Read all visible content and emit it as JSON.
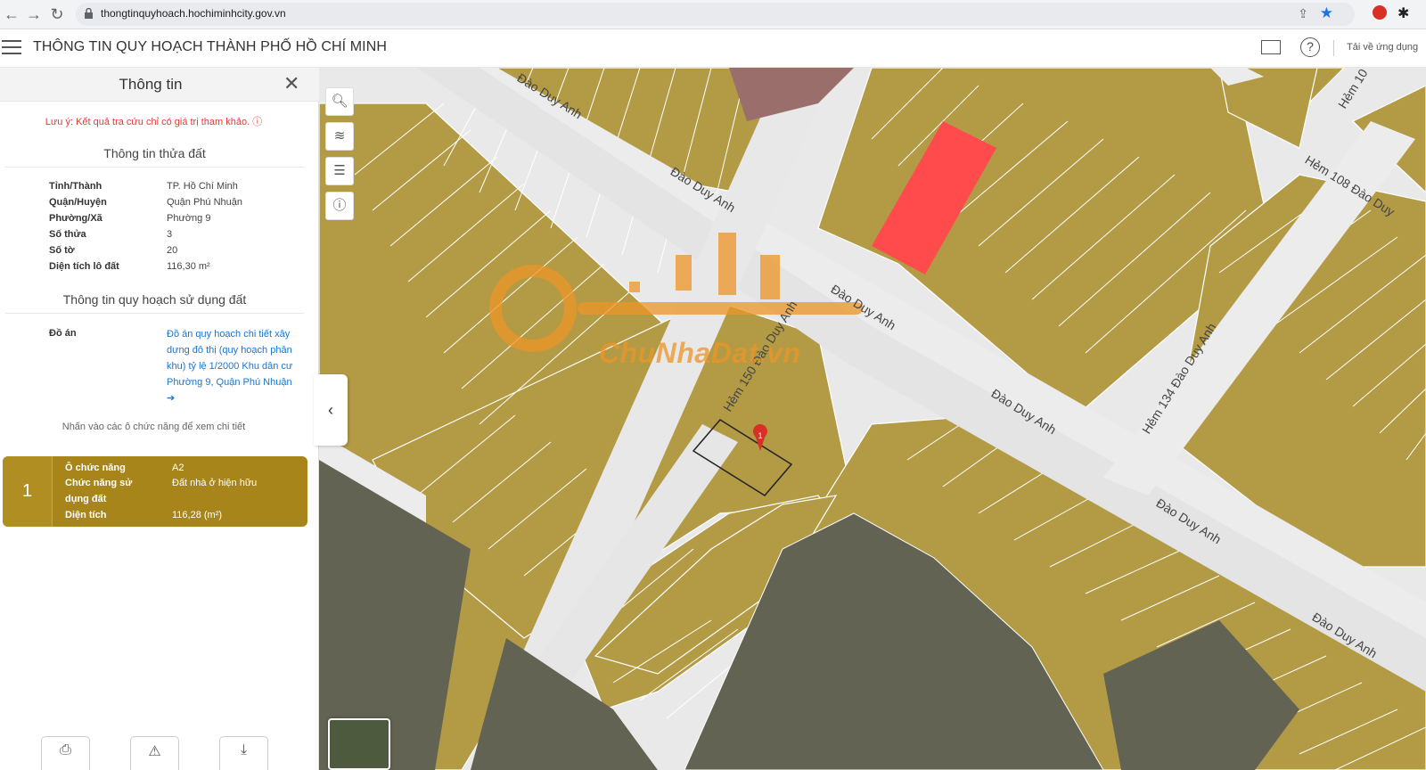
{
  "browser": {
    "url": "thongtinquyhoach.hochiminhcity.gov.vn"
  },
  "app": {
    "title": "THÔNG TIN QUY HOẠCH THÀNH PHỐ HỒ CHÍ MINH",
    "download_label": "Tải về ứng dụng"
  },
  "panel": {
    "title": "Thông tin",
    "note": "Lưu ý: Kết quả tra cứu chỉ có giá trị tham khảo.",
    "section1": "Thông tin thửa đất",
    "parcel": [
      {
        "k": "Tỉnh/Thành",
        "v": "TP. Hồ Chí Minh"
      },
      {
        "k": "Quận/Huyện",
        "v": "Quận Phú Nhuận"
      },
      {
        "k": "Phường/Xã",
        "v": "Phường 9"
      },
      {
        "k": "Số thửa",
        "v": "3"
      },
      {
        "k": "Số tờ",
        "v": "20"
      },
      {
        "k": "Diện tích lô đất",
        "v": "116,30 m²"
      }
    ],
    "section2": "Thông tin quy hoạch sử dụng đất",
    "doan_label": "Đồ án",
    "doan_link": "Đồ án quy hoạch chi tiết xây dựng đô thị (quy hoạch phân khu) tỷ lệ 1/2000 Khu dân cư Phường 9, Quận Phú Nhuận",
    "hint": "Nhấn vào các ô chức năng để xem chi tiết",
    "card": {
      "index": "1",
      "o_chuc_nang_label": "Ô chức năng",
      "o_chuc_nang_value": "A2",
      "chuc_nang_label_1": "Chức năng sử",
      "chuc_nang_label_2": "dụng đất",
      "chuc_nang_value": "Đất nhà ở hiện hữu",
      "dien_tich_label": "Diện tích",
      "dien_tich_value": "116,28 (m²)"
    }
  },
  "map": {
    "watermark": "ChuNhaDat.vn",
    "streets": [
      "Đào Duy Anh",
      "Đào Duy Anh",
      "Đào Duy Anh",
      "Đào Duy Anh",
      "Đào Duy Anh",
      "Đào Duy Anh",
      "Hẻm 108 Đào Duy",
      "Hẻm 134 Đào Duy Anh",
      "Hẻm 150 Đào Duy Anh",
      "Hẻm 10"
    ],
    "marker_label": "1",
    "colors": {
      "residential": "#b39a45",
      "highlight": "#ff4b4b",
      "dark_block": "#636353",
      "road": "#ececec"
    }
  }
}
